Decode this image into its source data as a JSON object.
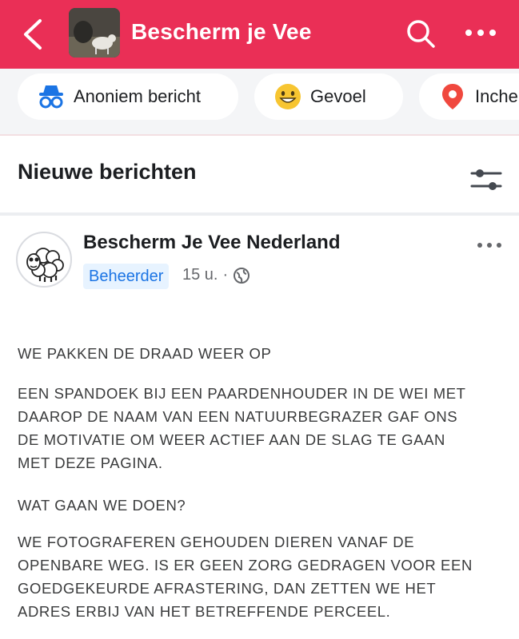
{
  "header": {
    "title": "Bescherm je Vee",
    "back_icon": "chevron-left-icon",
    "search_icon": "search-icon",
    "more_icon": "more-horizontal-icon",
    "bar_color": "#ea2f56"
  },
  "actions": [
    {
      "label": "Anoniem bericht",
      "icon": "incognito-icon"
    },
    {
      "label": "Gevoel",
      "icon": "smiley-icon"
    },
    {
      "label": "Inche",
      "icon": "location-pin-icon"
    }
  ],
  "feed": {
    "section_title": "Nieuwe berichten",
    "filter_icon": "sliders-icon"
  },
  "post": {
    "author": "Bescherm Je Vee Nederland",
    "role": "Beheerder",
    "time": "15 u.",
    "separator": "·",
    "privacy_icon": "globe-icon",
    "avatar_icon": "sheep-avatar-icon",
    "paragraphs": [
      [
        "WE PAKKEN DE DRAAD WEER OP"
      ],
      [
        "EEN SPANDOEK BIJ EEN PAARDENHOUDER IN DE WEI MET",
        "DAAROP DE NAAM VAN EEN NATUURBEGRAZER GAF ONS",
        "DE MOTIVATIE OM WEER ACTIEF AAN DE SLAG TE GAAN",
        "MET DEZE PAGINA."
      ],
      [
        "WAT GAAN WE DOEN?"
      ],
      [
        "WE FOTOGRAFEREN GEHOUDEN DIEREN VANAF DE",
        "OPENBARE WEG. IS ER GEEN ZORG GEDRAGEN VOOR EEN",
        "GOEDGEKEURDE AFRASTERING, DAN ZETTEN WE HET",
        "ADRES ERBIJ VAN HET BETREFFENDE PERCEEL."
      ]
    ]
  }
}
